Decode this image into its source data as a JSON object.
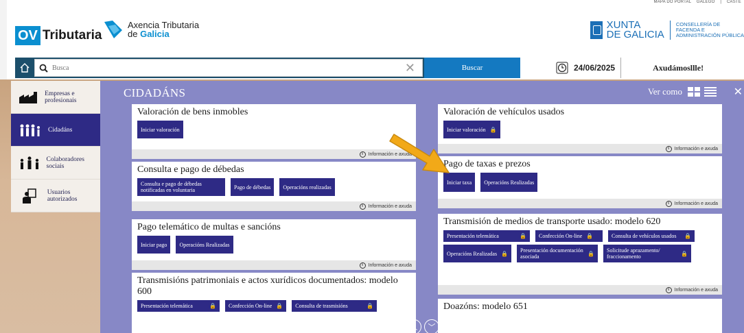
{
  "top_links": [
    "MAPA DO PORTAL",
    "GALEGO",
    "|",
    "CASTE"
  ],
  "header": {
    "ov_mark": "OV",
    "ov_title": "Tributaria",
    "agency_line1": "Axencia Tributaria",
    "agency_line2_prefix": "de ",
    "agency_line2_brand": "Galicia",
    "xunta_line1": "XUNTA",
    "xunta_line2": "DE GALICIA",
    "consellaria": [
      "CONSELLERÍA DE",
      "FACENDA E",
      "ADMINISTRACIÓN PÚBLICA"
    ]
  },
  "search": {
    "placeholder": "Busca",
    "button_label": "Buscar",
    "date": "24/06/2025",
    "help_label": "Axudámosllle!"
  },
  "sidebar": {
    "items": [
      {
        "label": "Empresas e profesionais",
        "icon": "factory-icon",
        "active": false
      },
      {
        "label": "Cidadáns",
        "icon": "people-icon",
        "active": true
      },
      {
        "label": "Colaboradores sociais",
        "icon": "collaborators-icon",
        "active": false
      },
      {
        "label": "Usuarios autorizados",
        "icon": "authorized-user-icon",
        "active": false
      }
    ]
  },
  "main": {
    "title": "CIDADÁNS",
    "view_as": "Ver como",
    "info_label": "Información e axuda",
    "cards": [
      {
        "title": "Valoración de bens inmobles",
        "buttons": [
          "Iniciar valoración"
        ]
      },
      {
        "title": "Consulta e pago de débedas",
        "buttons": [
          "Consulta e pago de débedas notificadas en voluntaria",
          "Pago de débedas",
          "Operacións realizadas"
        ]
      },
      {
        "title": "Pago telemático de multas e sancións",
        "buttons": [
          "Iniciar pago",
          "Operacións Realizadas"
        ]
      },
      {
        "title": "Transmisións patrimoniais e actos xurídicos documentados: modelo 600",
        "buttons": [
          "Presentación telemática",
          "Confección On-line",
          "Consulta de trasmisións"
        ]
      },
      {
        "title": "Valoración de vehículos usados",
        "buttons": [
          "Iniciar valoración"
        ]
      },
      {
        "title": "Pago de taxas e prezos",
        "buttons": [
          "Iniciar taxa",
          "Operacións Realizadas"
        ]
      },
      {
        "title": "Transmisión de medios de transporte usado: modelo 620",
        "buttons": [
          "Presentación telemática",
          "Confección On-line",
          "Consulta de vehículos usados",
          "Operacións Realizadas",
          "Presentación documentación asociada",
          "Solicitude aprazamento/ fraccionamento"
        ]
      },
      {
        "title": "Doazóns: modelo 651",
        "buttons": []
      }
    ]
  },
  "colors": {
    "nav_dark": "#1c4f6b",
    "search_blue": "#1479c1",
    "content_bg": "#8788c6",
    "button_indigo": "#2e2a85",
    "brand_blue": "#0b8fd0",
    "arrow_orange": "#f2a918"
  }
}
